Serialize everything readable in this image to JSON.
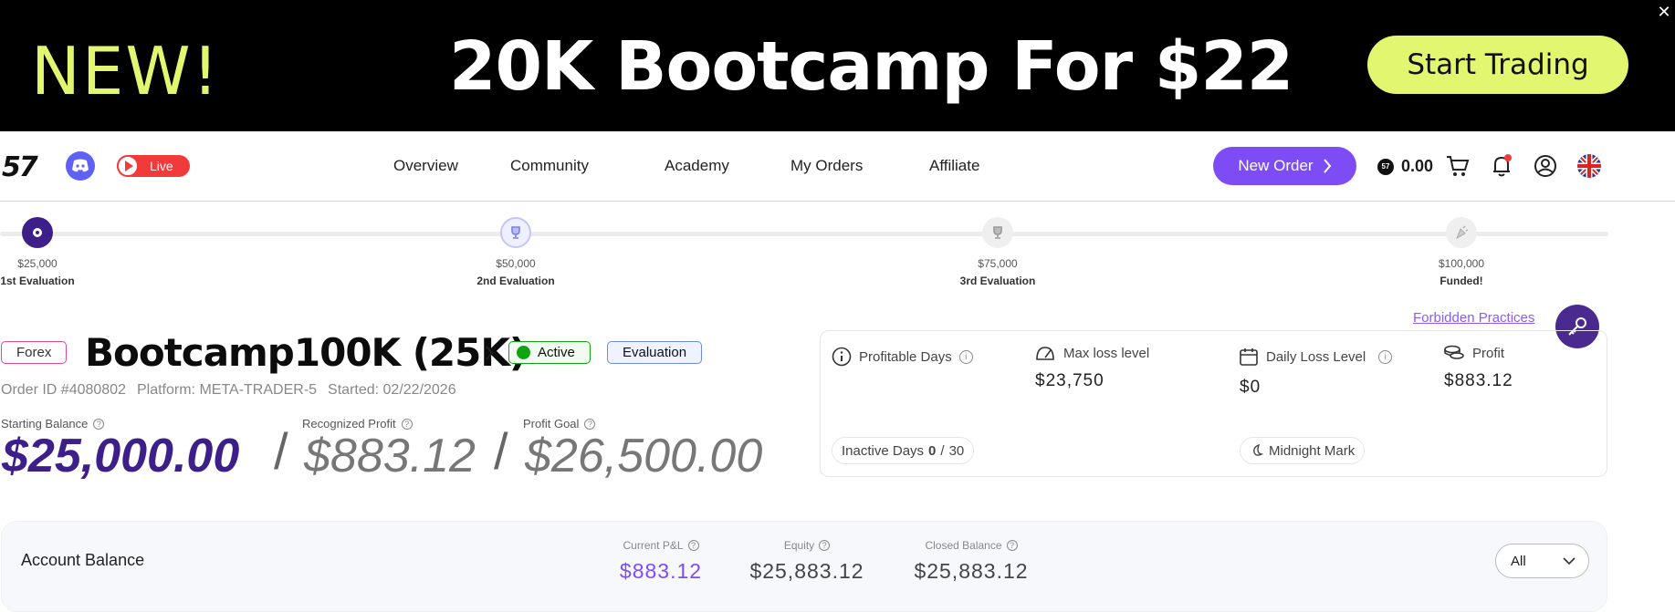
{
  "banner": {
    "new": "NEW!",
    "title": "20K Bootcamp For $22",
    "cta": "Start Trading",
    "close": "✕"
  },
  "nav": {
    "logo": "57",
    "live": "Live",
    "links": [
      "Overview",
      "Community",
      "Academy",
      "My Orders",
      "Affiliate"
    ],
    "new_order": "New Order",
    "coin_balance": "0.00"
  },
  "steps": [
    {
      "amount": "$25,000",
      "name": "1st Evaluation",
      "state": "current"
    },
    {
      "amount": "$50,000",
      "name": "2nd Evaluation",
      "state": "next"
    },
    {
      "amount": "$75,000",
      "name": "3rd Evaluation",
      "state": "locked"
    },
    {
      "amount": "$100,000",
      "name": "Funded!",
      "state": "locked"
    }
  ],
  "forbidden_link": "Forbidden Practices",
  "account": {
    "market": "Forex",
    "title": "Bootcamp100K (25K)",
    "status": "Active",
    "phase": "Evaluation",
    "order_id": "Order ID #4080802",
    "platform": "Platform: META-TRADER-5",
    "started": "Started: 02/22/2026"
  },
  "balances": {
    "starting_label": "Starting Balance",
    "starting_value": "$25,000.00",
    "recognized_label": "Recognized Profit",
    "recognized_value": "$883.12",
    "goal_label": "Profit Goal",
    "goal_value": "$26,500.00",
    "slash": "/"
  },
  "stats": {
    "profitable_days_label": "Profitable Days",
    "max_loss_label": "Max loss level",
    "max_loss_value": "$23,750",
    "daily_loss_label": "Daily Loss Level",
    "daily_loss_value": "$0",
    "profit_label": "Profit",
    "profit_value": "$883.12",
    "inactive_label": "Inactive Days",
    "inactive_current": "0",
    "inactive_sep": "/",
    "inactive_total": "30",
    "midnight": "Midnight Mark"
  },
  "account_balance": {
    "title": "Account Balance",
    "pnl_label": "Current P&L",
    "pnl_value": "$883.12",
    "equity_label": "Equity",
    "equity_value": "$25,883.12",
    "closed_label": "Closed Balance",
    "closed_value": "$25,883.12",
    "filter": "All"
  },
  "colors": {
    "accent": "#7d4cf5",
    "brand_dark": "#3d1f8a",
    "banner_lime": "#e3f66f",
    "live_red": "#f23a3a",
    "active_green": "#12a312"
  }
}
